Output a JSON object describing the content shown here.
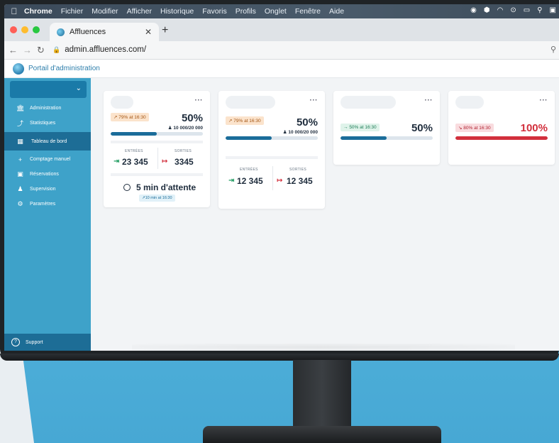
{
  "menubar": {
    "app": "Chrome",
    "items": [
      "Fichier",
      "Modifier",
      "Afficher",
      "Historique",
      "Favoris",
      "Profils",
      "Onglet",
      "Fenêtre",
      "Aide"
    ]
  },
  "browser": {
    "tab_title": "Affluences",
    "url": "admin.affluences.com/"
  },
  "app": {
    "portal_title": "Portail d'administration"
  },
  "sidebar": {
    "items": [
      {
        "label": "Administration",
        "icon": "bank-icon"
      },
      {
        "label": "Statistiques",
        "icon": "trend-icon"
      },
      {
        "label": "Tableau de bord",
        "icon": "dashboard-icon",
        "active": true
      },
      {
        "label": "Comptage manuel",
        "icon": "plus-icon"
      },
      {
        "label": "Réservations",
        "icon": "calendar-icon"
      },
      {
        "label": "Supervision",
        "icon": "people-icon"
      },
      {
        "label": "Paramètres",
        "icon": "gear-icon"
      }
    ],
    "support": "Support"
  },
  "cards": [
    {
      "trend": "79% at 16:30",
      "percent": "50%",
      "capacity": "10 000/20 000",
      "fill": 0.5,
      "entries_label": "ENTRÉES",
      "exits_label": "SORTIES",
      "entries": "23 345",
      "exits": "3345",
      "wait": "5 min d'attente",
      "wait_sub": "10 min at 16:30"
    },
    {
      "trend": "79% at 16:30",
      "percent": "50%",
      "capacity": "10 000/20 000",
      "fill": 0.5,
      "entries_label": "ENTRÉES",
      "exits_label": "SORTIES",
      "entries": "12 345",
      "exits": "12 345"
    },
    {
      "trend": "50% at 16:30",
      "percent": "50%",
      "fill": 0.5
    },
    {
      "trend": "80% at 16:30",
      "percent": "100%",
      "fill": 1.0
    }
  ],
  "colors": {
    "primary": "#1b6d9a",
    "sidebar": "#3ea2c9",
    "danger": "#d22f3c",
    "success": "#1c9a5e"
  }
}
